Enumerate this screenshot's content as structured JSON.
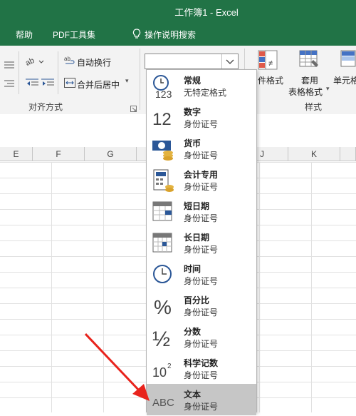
{
  "window": {
    "title": "工作簿1  -  Excel"
  },
  "menu": [
    {
      "label": "帮助"
    },
    {
      "label": "PDF工具集"
    },
    {
      "label": "操作说明搜索"
    }
  ],
  "ribbon": {
    "wrap_text": "自动换行",
    "merge_center": "合并后居中",
    "alignment_group": "对齐方式",
    "cond_format_label": "件格式",
    "table_format_label1": "套用",
    "table_format_label2": "表格格式",
    "cell_style_label": "单元格",
    "styles_group": "样式"
  },
  "number_format": {
    "value": ""
  },
  "columns": [
    "E",
    "F",
    "G",
    "J",
    "K"
  ],
  "formats": [
    {
      "label": "常规",
      "sub": "无特定格式",
      "icon": "general-clock-icon"
    },
    {
      "label": "数字",
      "sub": "身份证号",
      "icon": "number-icon",
      "glyph": "12"
    },
    {
      "label": "货币",
      "sub": "身份证号",
      "icon": "currency-icon"
    },
    {
      "label": "会计专用",
      "sub": " 身份证号",
      "icon": "accounting-icon"
    },
    {
      "label": "短日期",
      "sub": "身份证号",
      "icon": "short-date-icon"
    },
    {
      "label": "长日期",
      "sub": "身份证号",
      "icon": "long-date-icon"
    },
    {
      "label": "时间",
      "sub": "身份证号",
      "icon": "time-icon"
    },
    {
      "label": "百分比",
      "sub": "身份证号",
      "icon": "percent-icon",
      "glyph": "%"
    },
    {
      "label": "分数",
      "sub": "身份证号",
      "icon": "fraction-icon",
      "glyph": "½"
    },
    {
      "label": "科学记数",
      "sub": "身份证号",
      "icon": "scientific-icon",
      "glyph": "10"
    },
    {
      "label": "文本",
      "sub": "身份证号",
      "icon": "text-abc-icon",
      "glyph": "ABC"
    }
  ],
  "colors": {
    "excel_green": "#217346",
    "arrow_red": "#e8231c",
    "selected_bg": "#c6c6c6"
  }
}
